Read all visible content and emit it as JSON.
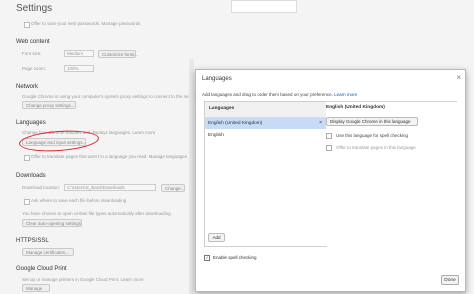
{
  "settings": {
    "title": "Settings",
    "sync_line": "Offer to save your web passwords. Manage passwords",
    "web_content_heading": "Web content",
    "font_size_label": "Font size:",
    "font_size_value": "Medium",
    "customize_fonts": "Customize fonts...",
    "page_zoom_label": "Page zoom:",
    "page_zoom_value": "100%",
    "network_heading": "Network",
    "network_desc": "Google Chrome is using your computer's system proxy settings to connect to the network.",
    "proxy_button": "Change proxy settings...",
    "languages_heading": "Languages",
    "languages_desc": "Change how Chrome handles and displays languages. Learn more",
    "language_button": "Language and input settings...",
    "translate_offer": "Offer to translate pages that aren't in a language you read. Manage languages",
    "downloads_heading": "Downloads",
    "download_location_label": "Download location:",
    "download_location_value": "C:\\Users\\S_Bass\\Downloads",
    "change_button": "Change...",
    "ask_save": "Ask where to save each file before downloading",
    "auto_open": "You have chosen to open certain file types automatically after downloading.",
    "clear_auto_open": "Clear auto-opening settings",
    "https_heading": "HTTPS/SSL",
    "manage_certs": "Manage certificates...",
    "cloud_print_heading": "Google Cloud Print",
    "cloud_print_desc": "Set up or manage printers in Google Cloud Print. Learn more",
    "manage_button": "Manage"
  },
  "dialog": {
    "title": "Languages",
    "close_glyph": "×",
    "description": "Add languages and drag to order them based on your preference.",
    "learn_more": "Learn more",
    "list_header": "Languages",
    "languages": [
      {
        "label": "English (United Kingdom)",
        "selected": true
      },
      {
        "label": "English",
        "selected": false
      }
    ],
    "remove_glyph": "×",
    "add_button": "Add",
    "detail_title": "English (United Kingdom)",
    "display_button": "Display Google Chrome in this language",
    "spell_option": "Use this language for spell checking",
    "translate_option": "Offer to translate pages in this language",
    "enable_spell": "Enable spell checking",
    "enable_spell_checked": true,
    "done_button": "Done"
  },
  "colors": {
    "selected_row": "#c7dbf6",
    "link": "#1155cc",
    "annotation": "#d8262a"
  }
}
